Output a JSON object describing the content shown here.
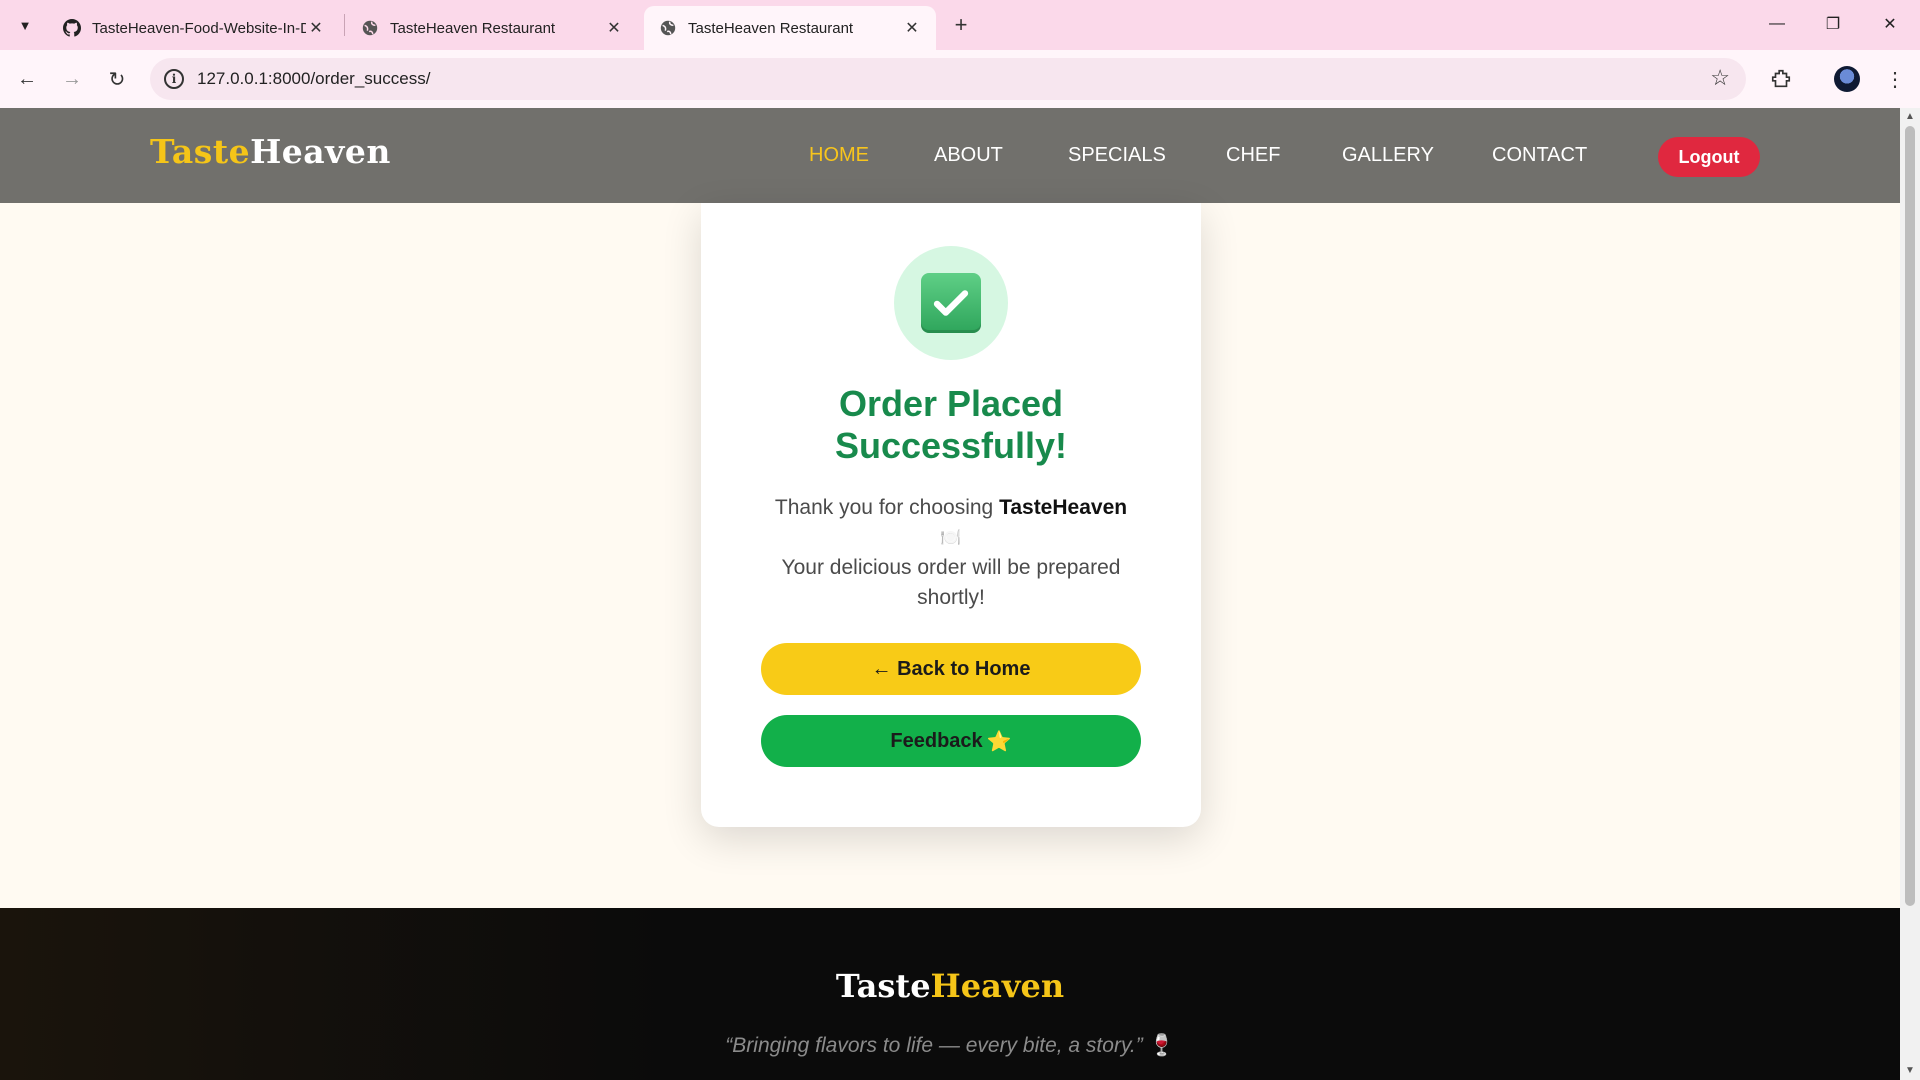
{
  "browser": {
    "tabs": [
      {
        "title": "TasteHeaven-Food-Website-In-D",
        "icon": "github-icon"
      },
      {
        "title": "TasteHeaven Restaurant",
        "icon": "globe-icon"
      },
      {
        "title": "TasteHeaven Restaurant",
        "icon": "globe-icon",
        "active": true
      }
    ],
    "url": "127.0.0.1:8000/order_success/"
  },
  "nav": {
    "logo_part1": "Taste",
    "logo_part2": "Heaven",
    "links": [
      "HOME",
      "ABOUT",
      "SPECIALS",
      "CHEF",
      "GALLERY",
      "CONTACT"
    ],
    "active_link": "HOME",
    "logout_label": "Logout"
  },
  "card": {
    "icon": "check-mark-icon",
    "title_line1": "Order Placed",
    "title_line2": "Successfully!",
    "message_prefix": "Thank you for choosing ",
    "message_brand": "TasteHeaven",
    "message_emoji": "🍽️",
    "message_line2": "Your delicious order will be prepared",
    "message_line3": "shortly!",
    "home_button": "← Back to Home",
    "feedback_button": "Feedback",
    "feedback_emoji": "⭐"
  },
  "footer": {
    "logo_part1": "Taste",
    "logo_part2": "Heaven",
    "tagline": "“Bringing flavors to life — every bite, a story.”",
    "tagline_emoji": "🍷"
  },
  "colors": {
    "nav_bg": "#71706c",
    "accent_yellow": "#f8c51c",
    "logout_red": "#e0283f",
    "success_green": "#188a4c",
    "feedback_green": "#12b04a",
    "page_bg": "#fffaf2"
  }
}
